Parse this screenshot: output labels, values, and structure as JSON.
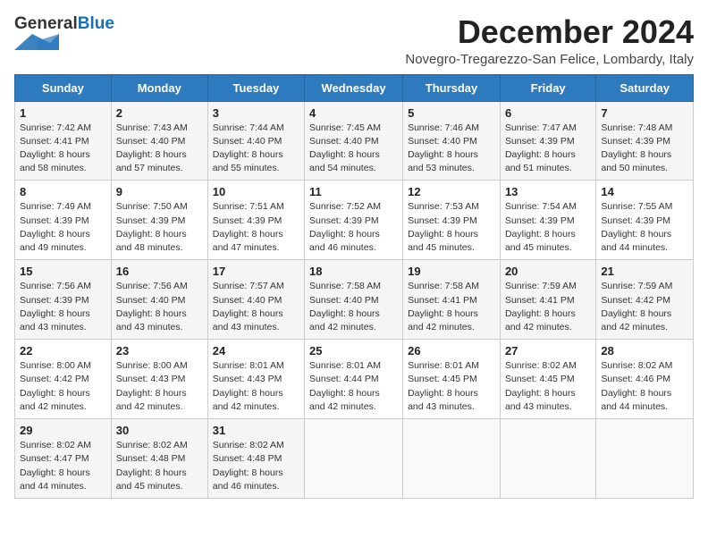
{
  "header": {
    "logo_general": "General",
    "logo_blue": "Blue",
    "month_title": "December 2024",
    "subtitle": "Novegro-Tregarezzo-San Felice, Lombardy, Italy"
  },
  "days_of_week": [
    "Sunday",
    "Monday",
    "Tuesday",
    "Wednesday",
    "Thursday",
    "Friday",
    "Saturday"
  ],
  "weeks": [
    [
      {
        "day": "1",
        "sunrise": "Sunrise: 7:42 AM",
        "sunset": "Sunset: 4:41 PM",
        "daylight": "Daylight: 8 hours and 58 minutes."
      },
      {
        "day": "2",
        "sunrise": "Sunrise: 7:43 AM",
        "sunset": "Sunset: 4:40 PM",
        "daylight": "Daylight: 8 hours and 57 minutes."
      },
      {
        "day": "3",
        "sunrise": "Sunrise: 7:44 AM",
        "sunset": "Sunset: 4:40 PM",
        "daylight": "Daylight: 8 hours and 55 minutes."
      },
      {
        "day": "4",
        "sunrise": "Sunrise: 7:45 AM",
        "sunset": "Sunset: 4:40 PM",
        "daylight": "Daylight: 8 hours and 54 minutes."
      },
      {
        "day": "5",
        "sunrise": "Sunrise: 7:46 AM",
        "sunset": "Sunset: 4:40 PM",
        "daylight": "Daylight: 8 hours and 53 minutes."
      },
      {
        "day": "6",
        "sunrise": "Sunrise: 7:47 AM",
        "sunset": "Sunset: 4:39 PM",
        "daylight": "Daylight: 8 hours and 51 minutes."
      },
      {
        "day": "7",
        "sunrise": "Sunrise: 7:48 AM",
        "sunset": "Sunset: 4:39 PM",
        "daylight": "Daylight: 8 hours and 50 minutes."
      }
    ],
    [
      {
        "day": "8",
        "sunrise": "Sunrise: 7:49 AM",
        "sunset": "Sunset: 4:39 PM",
        "daylight": "Daylight: 8 hours and 49 minutes."
      },
      {
        "day": "9",
        "sunrise": "Sunrise: 7:50 AM",
        "sunset": "Sunset: 4:39 PM",
        "daylight": "Daylight: 8 hours and 48 minutes."
      },
      {
        "day": "10",
        "sunrise": "Sunrise: 7:51 AM",
        "sunset": "Sunset: 4:39 PM",
        "daylight": "Daylight: 8 hours and 47 minutes."
      },
      {
        "day": "11",
        "sunrise": "Sunrise: 7:52 AM",
        "sunset": "Sunset: 4:39 PM",
        "daylight": "Daylight: 8 hours and 46 minutes."
      },
      {
        "day": "12",
        "sunrise": "Sunrise: 7:53 AM",
        "sunset": "Sunset: 4:39 PM",
        "daylight": "Daylight: 8 hours and 45 minutes."
      },
      {
        "day": "13",
        "sunrise": "Sunrise: 7:54 AM",
        "sunset": "Sunset: 4:39 PM",
        "daylight": "Daylight: 8 hours and 45 minutes."
      },
      {
        "day": "14",
        "sunrise": "Sunrise: 7:55 AM",
        "sunset": "Sunset: 4:39 PM",
        "daylight": "Daylight: 8 hours and 44 minutes."
      }
    ],
    [
      {
        "day": "15",
        "sunrise": "Sunrise: 7:56 AM",
        "sunset": "Sunset: 4:39 PM",
        "daylight": "Daylight: 8 hours and 43 minutes."
      },
      {
        "day": "16",
        "sunrise": "Sunrise: 7:56 AM",
        "sunset": "Sunset: 4:40 PM",
        "daylight": "Daylight: 8 hours and 43 minutes."
      },
      {
        "day": "17",
        "sunrise": "Sunrise: 7:57 AM",
        "sunset": "Sunset: 4:40 PM",
        "daylight": "Daylight: 8 hours and 43 minutes."
      },
      {
        "day": "18",
        "sunrise": "Sunrise: 7:58 AM",
        "sunset": "Sunset: 4:40 PM",
        "daylight": "Daylight: 8 hours and 42 minutes."
      },
      {
        "day": "19",
        "sunrise": "Sunrise: 7:58 AM",
        "sunset": "Sunset: 4:41 PM",
        "daylight": "Daylight: 8 hours and 42 minutes."
      },
      {
        "day": "20",
        "sunrise": "Sunrise: 7:59 AM",
        "sunset": "Sunset: 4:41 PM",
        "daylight": "Daylight: 8 hours and 42 minutes."
      },
      {
        "day": "21",
        "sunrise": "Sunrise: 7:59 AM",
        "sunset": "Sunset: 4:42 PM",
        "daylight": "Daylight: 8 hours and 42 minutes."
      }
    ],
    [
      {
        "day": "22",
        "sunrise": "Sunrise: 8:00 AM",
        "sunset": "Sunset: 4:42 PM",
        "daylight": "Daylight: 8 hours and 42 minutes."
      },
      {
        "day": "23",
        "sunrise": "Sunrise: 8:00 AM",
        "sunset": "Sunset: 4:43 PM",
        "daylight": "Daylight: 8 hours and 42 minutes."
      },
      {
        "day": "24",
        "sunrise": "Sunrise: 8:01 AM",
        "sunset": "Sunset: 4:43 PM",
        "daylight": "Daylight: 8 hours and 42 minutes."
      },
      {
        "day": "25",
        "sunrise": "Sunrise: 8:01 AM",
        "sunset": "Sunset: 4:44 PM",
        "daylight": "Daylight: 8 hours and 42 minutes."
      },
      {
        "day": "26",
        "sunrise": "Sunrise: 8:01 AM",
        "sunset": "Sunset: 4:45 PM",
        "daylight": "Daylight: 8 hours and 43 minutes."
      },
      {
        "day": "27",
        "sunrise": "Sunrise: 8:02 AM",
        "sunset": "Sunset: 4:45 PM",
        "daylight": "Daylight: 8 hours and 43 minutes."
      },
      {
        "day": "28",
        "sunrise": "Sunrise: 8:02 AM",
        "sunset": "Sunset: 4:46 PM",
        "daylight": "Daylight: 8 hours and 44 minutes."
      }
    ],
    [
      {
        "day": "29",
        "sunrise": "Sunrise: 8:02 AM",
        "sunset": "Sunset: 4:47 PM",
        "daylight": "Daylight: 8 hours and 44 minutes."
      },
      {
        "day": "30",
        "sunrise": "Sunrise: 8:02 AM",
        "sunset": "Sunset: 4:48 PM",
        "daylight": "Daylight: 8 hours and 45 minutes."
      },
      {
        "day": "31",
        "sunrise": "Sunrise: 8:02 AM",
        "sunset": "Sunset: 4:48 PM",
        "daylight": "Daylight: 8 hours and 46 minutes."
      },
      null,
      null,
      null,
      null
    ]
  ]
}
